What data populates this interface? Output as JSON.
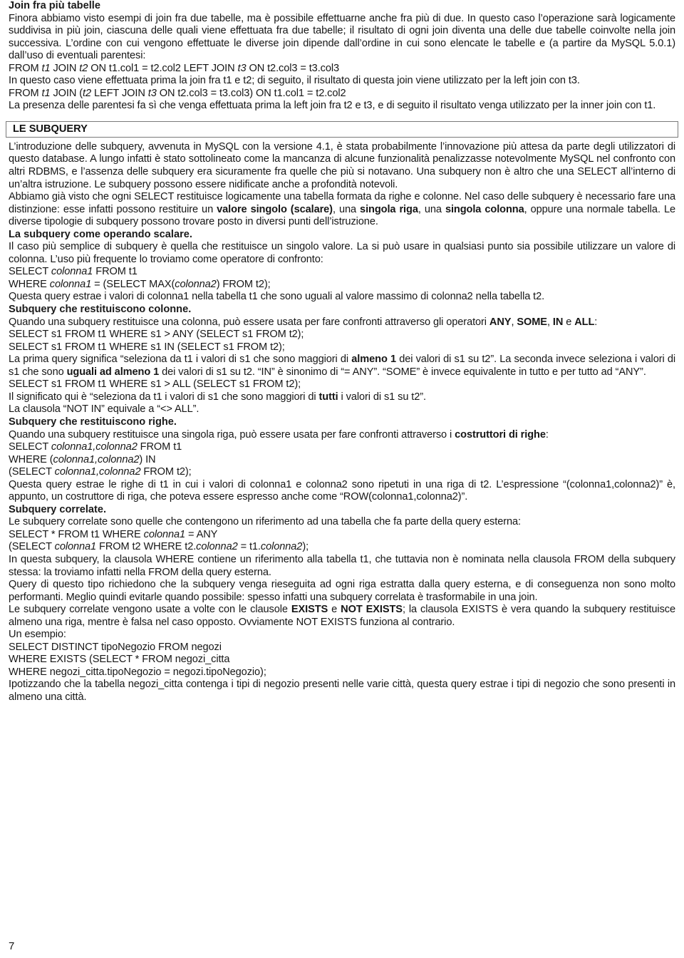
{
  "document": {
    "page_number": "7",
    "section1": {
      "heading": "Join fra più tabelle",
      "para1": "Finora abbiamo visto esempi di join fra due tabelle, ma è possibile effettuarne anche fra più di due. In questo caso l’operazione sarà logicamente suddivisa in più join, ciascuna delle quali viene effettuata fra due tabelle; il risultato di ogni join diventa una delle due tabelle coinvolte nella join successiva. L’ordine con cui vengono effettuate le diverse join dipende dall’ordine in cui sono elencate le tabelle e (a partire da MySQL 5.0.1) dall’uso di eventuali parentesi:",
      "code1_a": "FROM ",
      "code1_t1": "t1",
      "code1_b": " JOIN ",
      "code1_t2": "t2",
      "code1_c": " ON t1.col1 = t2.col2 LEFT JOIN ",
      "code1_t3": "t3",
      "code1_d": " ON t2.col3 = t3.col3",
      "para2": "In questo caso viene effettuata prima la join fra t1 e t2; di seguito, il risultato di questa join viene utilizzato per la left join con t3.",
      "code2_a": "FROM ",
      "code2_t1": "t1",
      "code2_b": " JOIN (",
      "code2_t2": "t2",
      "code2_c": " LEFT JOIN ",
      "code2_t3": "t3",
      "code2_d": " ON t2.col3 = t3.col3) ON t1.col1 = t2.col2",
      "para3": "La presenza delle parentesi fa sì che venga effettuata prima la left join fra t2 e t3, e di seguito il risultato venga utilizzato per la inner join con t1."
    },
    "section2": {
      "box_title": "LE SUBQUERY",
      "para1": "L’introduzione delle subquery, avvenuta in MySQL con la versione 4.1, è stata probabilmente l’innovazione più attesa da parte degli utilizzatori di questo database. A lungo infatti è stato sottolineato come la mancanza di alcune funzionalità penalizzasse notevolmente MySQL nel confronto con altri RDBMS, e l’assenza delle subquery era sicuramente fra quelle che più si notavano. Una subquery non è altro che una SELECT all’interno di un’altra istruzione. Le subquery possono essere nidificate anche a profondità notevoli.",
      "para2_a": "Abbiamo già visto che ogni SELECT restituisce logicamente una tabella formata da righe e colonne. Nel caso delle subquery è necessario fare una distinzione: esse infatti possono restituire un ",
      "para2_b1": "valore singolo (scalare)",
      "para2_c": ", una ",
      "para2_b2": "singola riga",
      "para2_d": ", una ",
      "para2_b3": "singola colonna",
      "para2_e": ", oppure una normale tabella. Le diverse tipologie di subquery possono trovare posto in diversi punti dell’istruzione.",
      "sub1_heading": "La subquery come operando scalare.",
      "para3": "Il caso più semplice di subquery è quella che restituisce un singolo valore. La si può usare in qualsiasi punto sia possibile utilizzare un valore di colonna. L’uso più frequente lo troviamo come operatore di confronto:",
      "code3_a": "SELECT ",
      "code3_i": "colonna1",
      "code3_b": " FROM t1",
      "code4_a": "WHERE ",
      "code4_i1": "colonna1",
      "code4_b": " = (SELECT MAX(",
      "code4_i2": "colonna2",
      "code4_c": ") FROM t2);",
      "para4": "Questa query estrae i valori di colonna1 nella tabella t1 che sono uguali al valore massimo di colonna2 nella tabella t2.",
      "sub2_heading": "Subquery che restituiscono colonne.",
      "para5_a": "Quando una subquery restituisce una colonna, può essere usata per fare confronti attraverso gli operatori ",
      "para5_b1": "ANY",
      "para5_c": ", ",
      "para5_b2": "SOME",
      "para5_d": ", ",
      "para5_b3": "IN",
      "para5_e": " e ",
      "para5_b4": "ALL",
      "para5_f": ":",
      "code5": "SELECT s1 FROM t1 WHERE s1 > ANY (SELECT s1 FROM t2);",
      "code6": "SELECT s1 FROM t1 WHERE s1 IN (SELECT s1 FROM t2);",
      "para6_a": "La prima query significa “seleziona da t1 i valori di s1 che sono maggiori di ",
      "para6_b1": "almeno 1",
      "para6_c": " dei valori di s1 su t2”. La seconda invece seleziona i valori di s1 che sono ",
      "para6_b2": "uguali ad almeno 1",
      "para6_d": " dei valori di s1 su t2. “IN” è sinonimo di “= ANY”. “SOME” è invece equivalente in tutto e per tutto ad “ANY”.",
      "code7": "SELECT s1 FROM t1 WHERE s1 > ALL (SELECT s1 FROM t2);",
      "para7_a": "Il significato qui è “seleziona da t1 i valori di s1 che sono maggiori di ",
      "para7_b": "tutti",
      "para7_c": " i valori di s1 su t2”.",
      "para8": "La clausola “NOT IN” equivale a “<> ALL”.",
      "sub3_heading": "Subquery che restituiscono righe.",
      "para9_a": "Quando una subquery restituisce una singola riga, può essere usata per fare confronti attraverso i ",
      "para9_b": "costruttori di righe",
      "para9_c": ":",
      "code8_a": "SELECT ",
      "code8_i": "colonna1,colonna2",
      "code8_b": " FROM t1",
      "code9_a": "WHERE (",
      "code9_i": "colonna1,colonna2",
      "code9_b": ") IN",
      "code10_a": "(SELECT ",
      "code10_i": "colonna1,colonna2",
      "code10_b": " FROM t2);",
      "para10": "Questa query estrae le righe di t1 in cui i valori di colonna1 e colonna2 sono ripetuti in una riga di t2. L’espressione “(colonna1,colonna2)” è, appunto, un costruttore di riga, che poteva essere espresso anche come “ROW(colonna1,colonna2)”.",
      "sub4_heading": "Subquery correlate.",
      "para11": "Le subquery correlate sono quelle che contengono un riferimento ad una tabella che fa parte della query esterna:",
      "code11_a": "SELECT * FROM t1 WHERE ",
      "code11_i": "colonna1",
      "code11_b": " = ANY",
      "code12_a": "(SELECT ",
      "code12_i1": "colonna1",
      "code12_b": " FROM t2 WHERE t2.",
      "code12_i2": "colonna2",
      "code12_c": " = t1.",
      "code12_i3": "colonna2",
      "code12_d": ");",
      "para12": "In questa subquery, la clausola WHERE contiene un riferimento alla tabella t1, che tuttavia non è nominata nella clausola FROM della subquery stessa: la troviamo infatti nella FROM della query esterna.",
      "para13": "Query di questo tipo richiedono che la subquery venga rieseguita ad ogni riga estratta dalla query esterna, e di conseguenza non sono molto performanti. Meglio quindi evitarle quando possibile: spesso infatti una subquery correlata è trasformabile in una join.",
      "para14_a": "Le subquery correlate vengono usate a volte con le clausole ",
      "para14_b1": "EXISTS",
      "para14_c": " e ",
      "para14_b2": "NOT EXISTS",
      "para14_d": "; la clausola EXISTS è vera quando la subquery restituisce almeno una riga, mentre è falsa nel caso opposto. Ovviamente NOT EXISTS funziona al contrario.",
      "para15": "Un esempio:",
      "code13": "SELECT DISTINCT tipoNegozio FROM negozi",
      "code14": "WHERE EXISTS (SELECT * FROM negozi_citta",
      "code15": "WHERE negozi_citta.tipoNegozio = negozi.tipoNegozio);",
      "para16": "Ipotizzando che la tabella negozi_citta contenga i tipi di negozio presenti nelle varie città, questa query estrae i tipi di negozio che sono presenti in almeno una città."
    }
  }
}
